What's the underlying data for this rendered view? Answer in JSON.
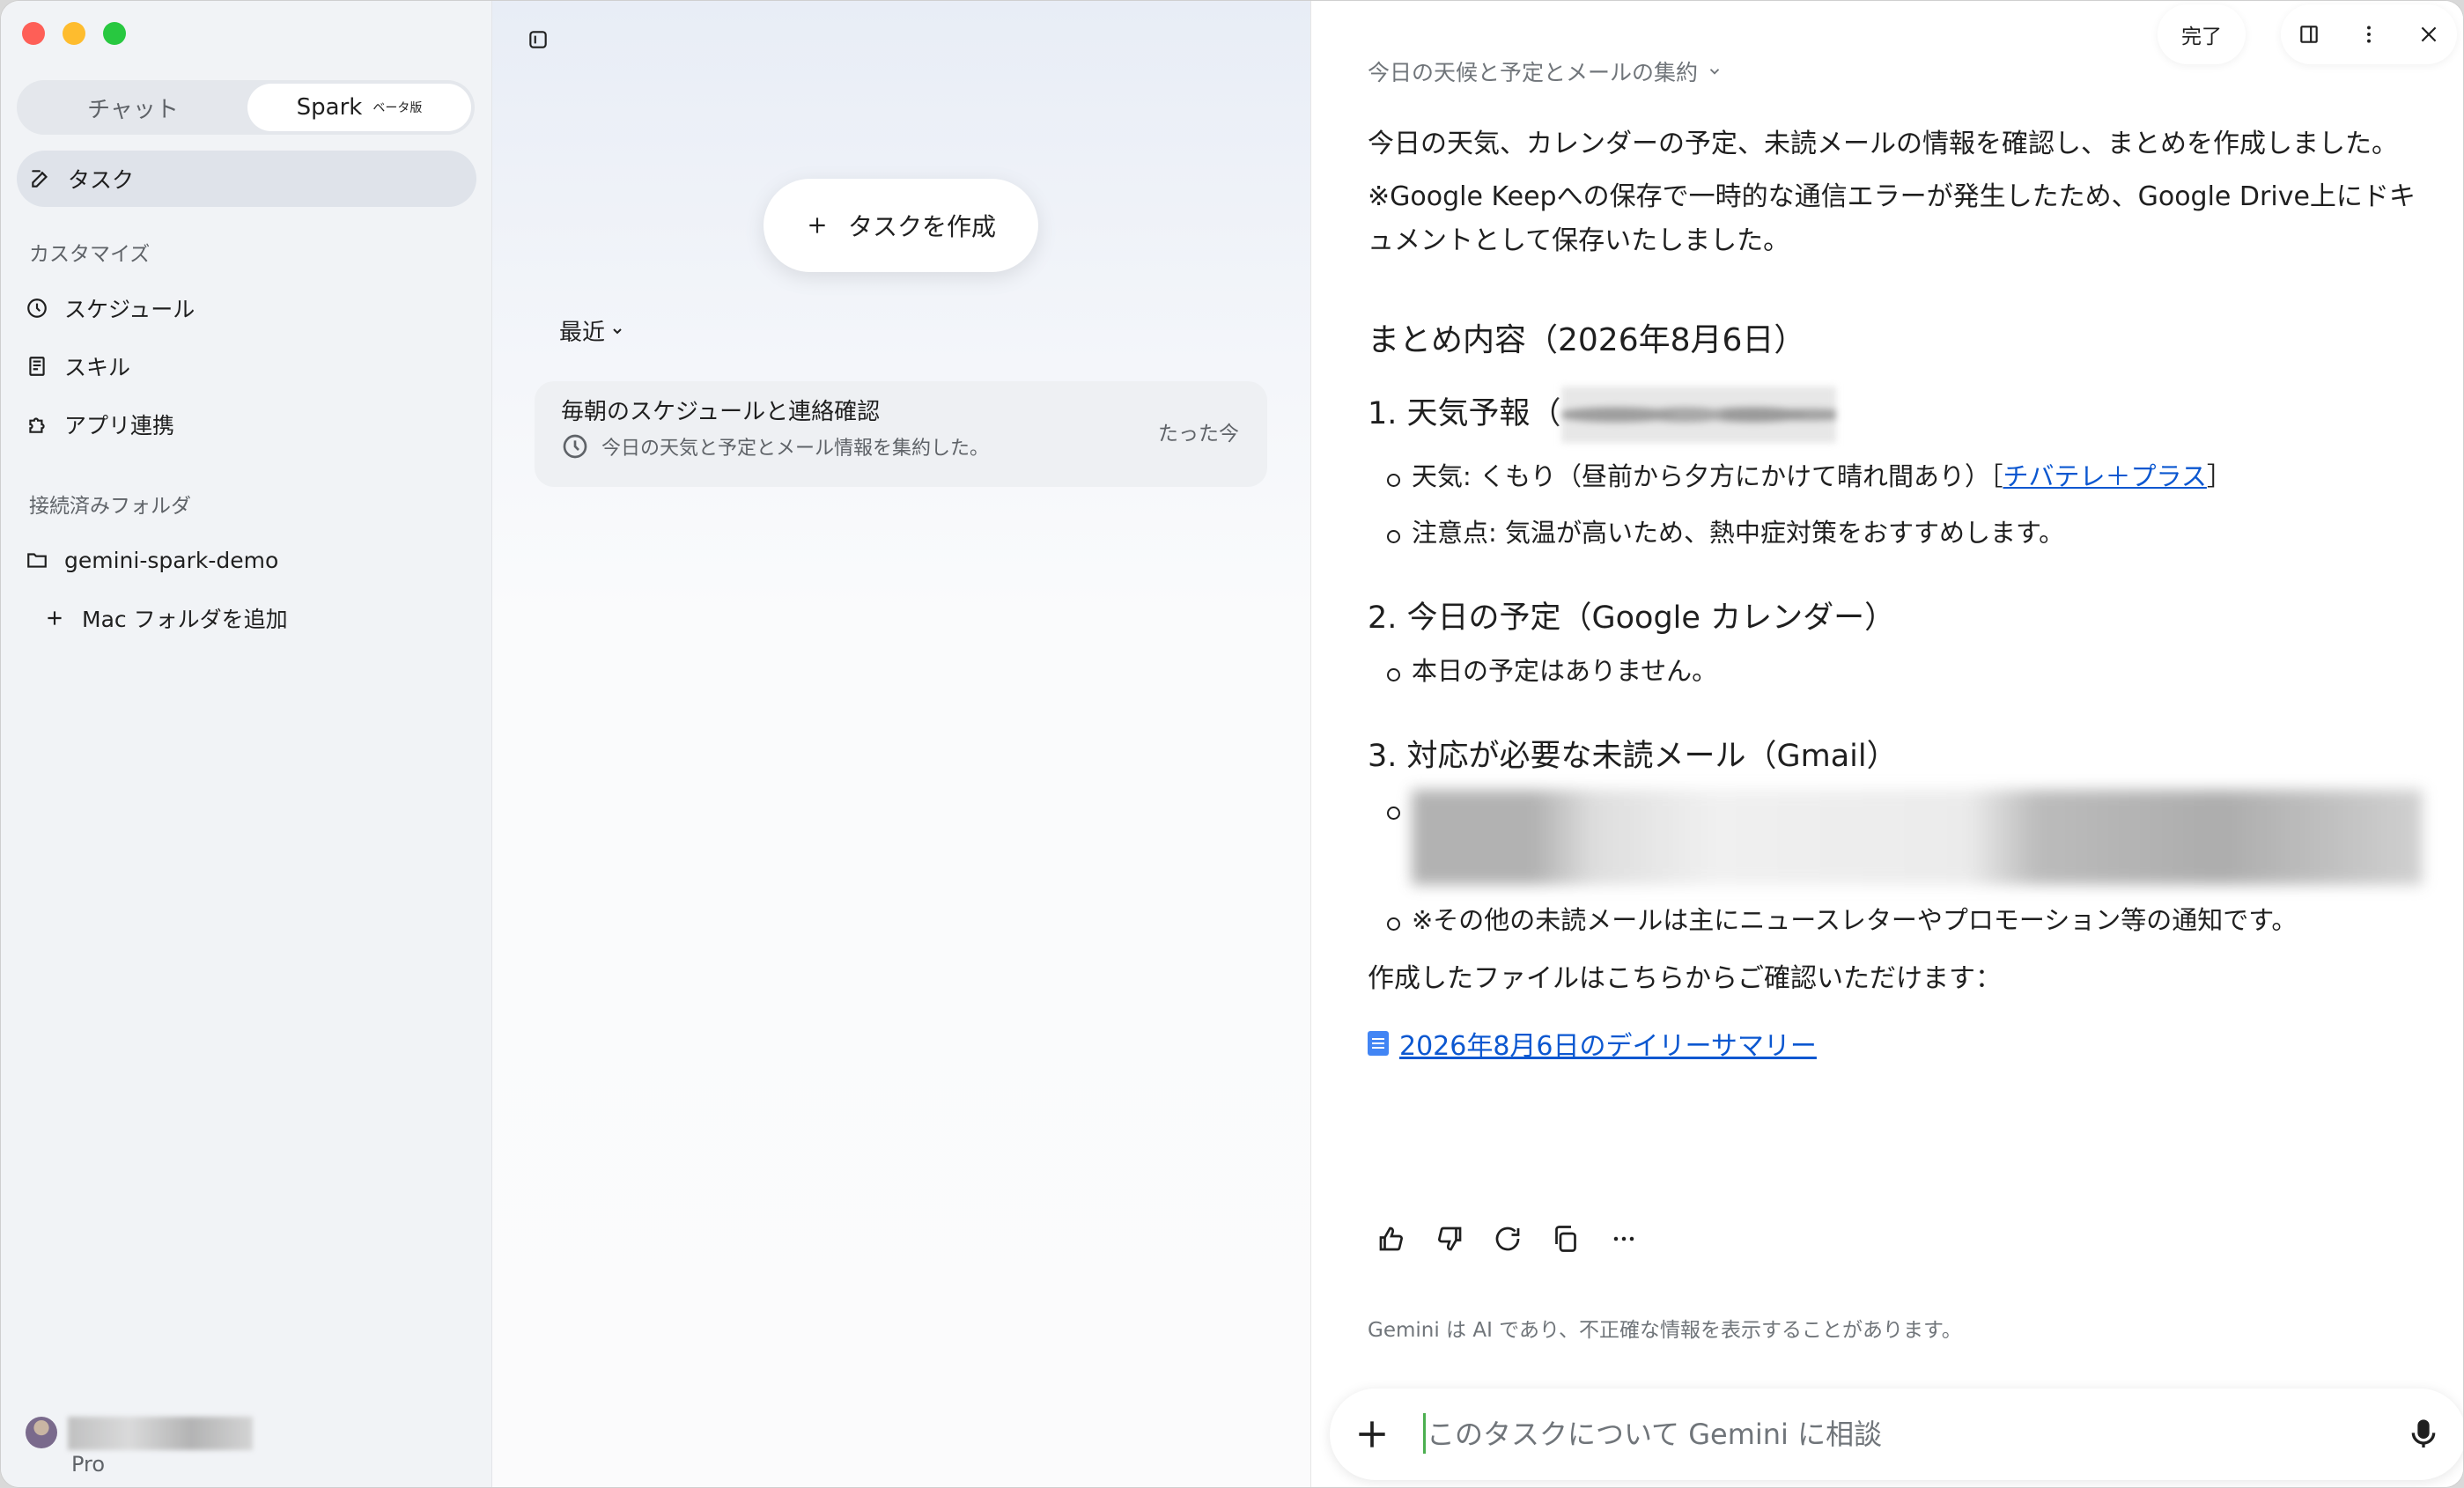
{
  "sidebar": {
    "tabs": {
      "chat": "チャット",
      "spark": "Spark",
      "beta": "ベータ版"
    },
    "task_label": "タスク",
    "customize_label": "カスタマイズ",
    "items": [
      {
        "label": "スケジュール",
        "icon": "clock-icon"
      },
      {
        "label": "スキル",
        "icon": "book-icon"
      },
      {
        "label": "アプリ連携",
        "icon": "puzzle-icon"
      }
    ],
    "folders_label": "接続済みフォルダ",
    "folder_name": "gemini-spark-demo",
    "add_folder_label": "Mac フォルダを追加",
    "user_plan": "Pro"
  },
  "middle": {
    "create_task_label": "タスクを作成",
    "recent_label": "最近",
    "task": {
      "title": "毎朝のスケジュールと連絡確認",
      "subtitle": "今日の天気と予定とメール情報を集約した。",
      "time": "たった今"
    }
  },
  "right": {
    "done_label": "完了",
    "breadcrumb": "今日の天候と予定とメールの集約",
    "intro": "今日の天気、カレンダーの予定、未読メールの情報を確認し、まとめを作成しました。",
    "note": "※Google Keepへの保存で一時的な通信エラーが発生したため、Google Drive上にドキュメントとして保存いたしました。",
    "summary_heading": "まとめ内容（2026年8月6日）",
    "section1": {
      "heading": "1. 天気予報（",
      "weather_prefix": "天気: くもり（昼前から夕方にかけて晴れ間あり）［",
      "weather_link": "チバテレ＋プラス",
      "weather_suffix": "］",
      "caution": "注意点: 気温が高いため、熱中症対策をおすすめします。"
    },
    "section2": {
      "heading": "2. 今日の予定（Google カレンダー）",
      "item": "本日の予定はありません。"
    },
    "section3": {
      "heading": "3. 対応が必要な未読メール（Gmail）",
      "other": "※その他の未読メールは主にニュースレターやプロモーション等の通知です。"
    },
    "file_prompt": "作成したファイルはこちらからご確認いただけます：",
    "file_link": "2026年8月6日のデイリーサマリー",
    "disclaimer": "Gemini は AI であり、不正確な情報を表示することがあります。",
    "composer_placeholder": "このタスクについて Gemini に相談"
  },
  "colors": {
    "accent_link": "#0b57d0",
    "close_red": "#fe5f57",
    "minimize_yellow": "#febc2e",
    "zoom_green": "#28c840"
  }
}
